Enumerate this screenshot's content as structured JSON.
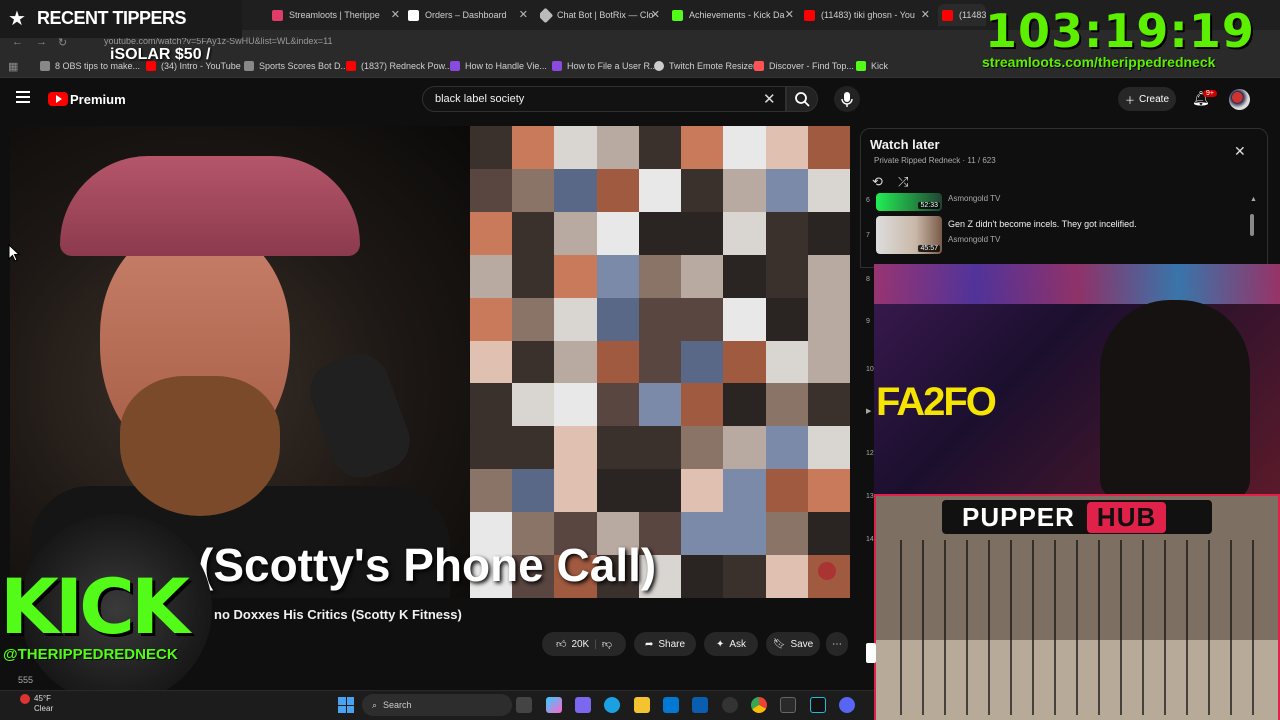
{
  "browser": {
    "tabs": [
      {
        "title": "Streamloots | Therippe",
        "color": "#e03c6a"
      },
      {
        "title": "Orders – Dashboard",
        "color": "#ffffff"
      },
      {
        "title": "Chat Bot | BotRix — Clo",
        "color": "#bbbbbb"
      },
      {
        "title": "Achievements - Kick Da",
        "color": "#53fc18"
      },
      {
        "title": "(11483) tiki ghosn - You",
        "color": "#ff0000"
      },
      {
        "title": "(11483) Th",
        "color": "#ff0000"
      }
    ],
    "url": "youtube.com/watch?v=5FAy1z-SwHU&list=WL&index=11",
    "bookmarks": [
      {
        "label": "8 OBS tips to make...",
        "color": "#888888"
      },
      {
        "label": "(34) Intro - YouTube",
        "color": "#ff0000"
      },
      {
        "label": "Sports Scores Bot D...",
        "color": "#888888"
      },
      {
        "label": "(1837) Redneck Pow...",
        "color": "#ff0000"
      },
      {
        "label": "How to Handle Vie...",
        "color": "#8a4ae0"
      },
      {
        "label": "How to File a User R...",
        "color": "#8a4ae0"
      },
      {
        "label": "Twitch Emote Resizer",
        "color": "#cccccc"
      },
      {
        "label": "Discover - Find Top...",
        "color": "#ff5252"
      },
      {
        "label": "Kick",
        "color": "#53fc18"
      }
    ]
  },
  "youtube": {
    "brand": "Premium",
    "search_value": "black label society",
    "create_label": "Create",
    "notif_count": "9+",
    "video_caption": "(Scotty's Phone Call)",
    "video_title": "no Doxxes His Critics (Scotty K Fitness)",
    "actions": {
      "likes": "20K",
      "share": "Share",
      "ask": "Ask",
      "save": "Save"
    },
    "views_partial": "555"
  },
  "watch_later": {
    "title": "Watch later",
    "subtitle": "Private  Ripped Redneck · 11 / 623",
    "items": [
      {
        "index": "6",
        "duration": "52:33",
        "title": "",
        "channel": "Asmongold TV"
      },
      {
        "index": "7",
        "duration": "45:57",
        "title": "Gen Z didn't become incels. They got incelified.",
        "channel": "Asmongold TV"
      }
    ],
    "side_indices": [
      "8",
      "9",
      "10",
      "11",
      "12",
      "13",
      "14"
    ]
  },
  "overlays": {
    "tipper_title": "RECENT TIPPERS",
    "tipper_entry": "iSOLAR $50 /",
    "timer": "103:19:19",
    "stream_url": "streamloots.com/therippedredneck",
    "cam_sign": "FA2FO",
    "pupper_word1": "PUPPER",
    "pupper_word2": "HUB",
    "kick_word": "KICK",
    "kick_handle": "@THERIPPEDREDNECK"
  },
  "taskbar": {
    "temp": "45°F",
    "condition": "Clear",
    "search_placeholder": "Search"
  },
  "colors": {
    "kick_green": "#53fc18",
    "timer_green": "#5cf000",
    "yt_red": "#ff0000",
    "pupper_red": "#e0224a"
  }
}
